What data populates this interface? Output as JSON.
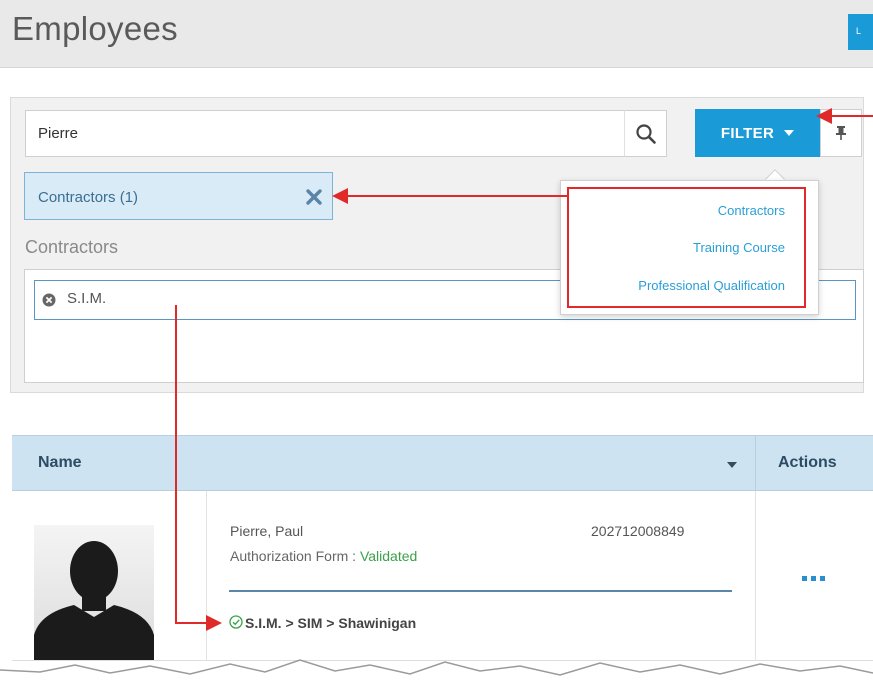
{
  "header": {
    "title": "Employees",
    "button_label": "L"
  },
  "search": {
    "value": "Pierre",
    "search_icon": "search-icon"
  },
  "filter": {
    "button_label": "FILTER",
    "pin_icon": "pin-icon"
  },
  "active_filter": {
    "label": "Contractors  (1)",
    "remove_icon": "close-icon"
  },
  "contractors_section": {
    "label": "Contractors",
    "tags": [
      {
        "label": "S.I.M.",
        "remove_icon": "remove-circle-icon"
      }
    ]
  },
  "filter_menu": {
    "items": [
      {
        "label": "Contractors"
      },
      {
        "label": "Training Course"
      },
      {
        "label": "Professional Qualification"
      }
    ]
  },
  "grid": {
    "columns": [
      {
        "label": "Name"
      },
      {
        "label": "Actions"
      }
    ],
    "rows": [
      {
        "name": "Pierre, Paul",
        "id": "202712008849",
        "auth_label": "Authorization Form : ",
        "auth_status": "Validated",
        "path": "S.I.M. > SIM > Shawinigan",
        "avatar_icon": "avatar-silhouette-icon",
        "actions_icon": "more-horizontal-icon"
      }
    ]
  },
  "colors": {
    "accent": "#1a9bd7",
    "chip_bg": "#d9ebf6",
    "menu_link": "#2a9fd6",
    "status_ok": "#3aa14a",
    "callout": "#e02a2a",
    "grid_header": "#cde3f2"
  }
}
